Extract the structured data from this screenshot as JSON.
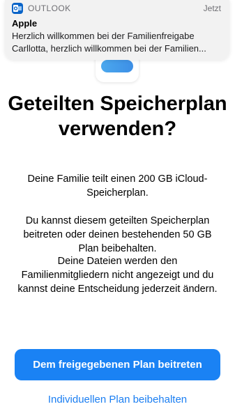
{
  "notification": {
    "app_name": "OUTLOOK",
    "app_icon": "outlook-icon",
    "time": "Jetzt",
    "title": "Apple",
    "line1": "Herzlich willkommen bei der Familienfreigabe",
    "line2": "Carllotta, herzlich willkommen bei der Familien..."
  },
  "headline": "Geteilten Speicherplan verwenden?",
  "paragraphs": {
    "p1": "Deine Familie teilt einen 200 GB iCloud-Speicherplan.",
    "p2": "Du kannst diesem geteilten Speicherplan beitreten oder deinen bestehenden 50 GB Plan beibehalten.",
    "p3": "Deine Dateien werden den Familienmitgliedern nicht angezeigt und du kannst deine Entscheidung jederzeit ändern."
  },
  "buttons": {
    "join": "Dem freigegebenen Plan beitreten",
    "keep": "Individuellen Plan beibehalten"
  },
  "colors": {
    "accent": "#1a82f4",
    "outlook_brand": "#0a64c8"
  }
}
